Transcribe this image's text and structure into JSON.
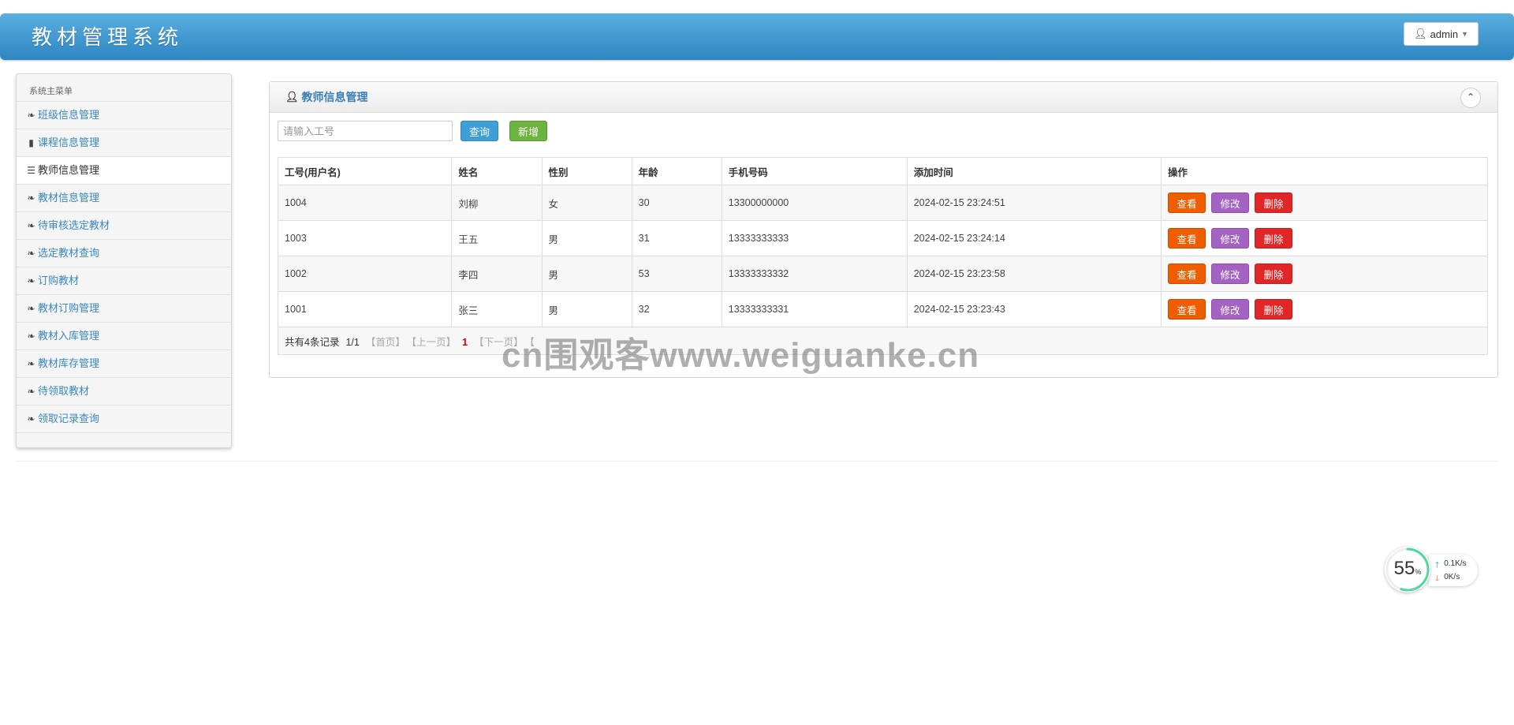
{
  "header": {
    "title": "教材管理系统",
    "user": "admin"
  },
  "sidebar": {
    "title": "系统主菜单",
    "items": [
      {
        "label": "班级信息管理",
        "icon": "leaf-icon"
      },
      {
        "label": "课程信息管理",
        "icon": "bookmark-icon"
      },
      {
        "label": "教师信息管理",
        "icon": "list-icon",
        "active": true
      },
      {
        "label": "教材信息管理",
        "icon": "leaf-icon"
      },
      {
        "label": "待审核选定教材",
        "icon": "leaf-icon"
      },
      {
        "label": "选定教材查询",
        "icon": "leaf-icon"
      },
      {
        "label": "订购教材",
        "icon": "leaf-icon"
      },
      {
        "label": "教材订购管理",
        "icon": "leaf-icon"
      },
      {
        "label": "教材入库管理",
        "icon": "leaf-icon"
      },
      {
        "label": "教材库存管理",
        "icon": "leaf-icon"
      },
      {
        "label": "待领取教材",
        "icon": "leaf-icon"
      },
      {
        "label": "领取记录查询",
        "icon": "leaf-icon"
      }
    ]
  },
  "panel": {
    "title": "教师信息管理",
    "search": {
      "placeholder": "请输入工号",
      "value": ""
    },
    "query_label": "查询",
    "add_label": "新增"
  },
  "table": {
    "columns": [
      "工号(用户名)",
      "姓名",
      "性别",
      "年龄",
      "手机号码",
      "添加时间",
      "操作"
    ],
    "rows": [
      [
        "1004",
        "刘柳",
        "女",
        "30",
        "13300000000",
        "2024-02-15 23:24:51"
      ],
      [
        "1003",
        "王五",
        "男",
        "31",
        "13333333333",
        "2024-02-15 23:24:14"
      ],
      [
        "1002",
        "李四",
        "男",
        "53",
        "13333333332",
        "2024-02-15 23:23:58"
      ],
      [
        "1001",
        "张三",
        "男",
        "32",
        "13333333331",
        "2024-02-15 23:23:43"
      ]
    ],
    "actions": {
      "view": "查看",
      "edit": "修改",
      "delete": "删除"
    }
  },
  "pager": {
    "summary": "共有4条记录",
    "pages": "1/1",
    "first": "【首页】",
    "prev": "【上一页】",
    "current": "1",
    "next": "【下一页】",
    "last": "【"
  },
  "watermark": "cn围观客www.weiguanke.cn",
  "speed_widget": {
    "percent": "55",
    "percent_unit": "%",
    "up": "0.1",
    "down": "0",
    "unit": "K/s"
  },
  "colors": {
    "header": "#3a94d0",
    "link": "#3a87c2",
    "view_button": "#f05d00",
    "edit_button": "#a462c2",
    "delete_button": "#e02626",
    "add_button": "#6cb33f",
    "query_button": "#3d9ed8"
  }
}
